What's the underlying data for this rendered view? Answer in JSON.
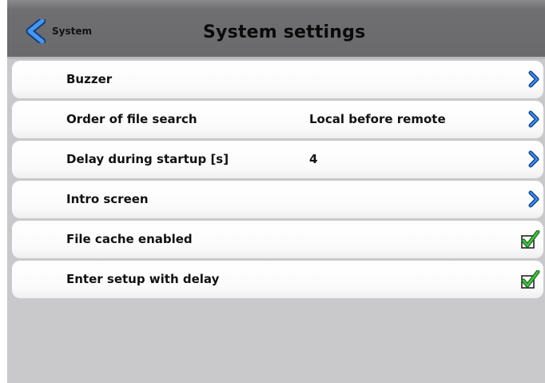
{
  "header": {
    "back_label": "System",
    "title": "System settings"
  },
  "rows": [
    {
      "label": "Buzzer",
      "value": "",
      "icon": "chevron-right-icon"
    },
    {
      "label": "Order of file search",
      "value": "Local before remote",
      "icon": "chevron-right-icon"
    },
    {
      "label": "Delay during startup [s]",
      "value": "4",
      "icon": "chevron-right-icon"
    },
    {
      "label": "Intro screen",
      "value": "",
      "icon": "chevron-right-icon"
    },
    {
      "label": "File cache enabled",
      "value": "",
      "icon": "checkbox-checked-icon",
      "checked": true
    },
    {
      "label": "Enter setup with delay",
      "value": "",
      "icon": "checkbox-checked-icon",
      "checked": true
    }
  ],
  "colors": {
    "accent_blue": "#1e63c6",
    "check_green": "#2fa32f",
    "header_gray": "#6c6c6e",
    "background_gray": "#c9c8ca"
  }
}
